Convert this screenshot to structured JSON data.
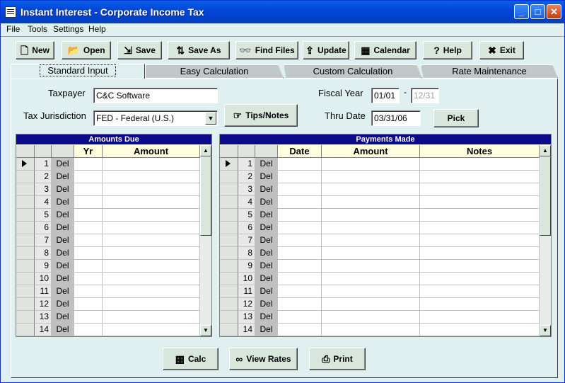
{
  "window": {
    "title": "Instant Interest - Corporate Income Tax",
    "minimize": "_",
    "maximize": "□",
    "close": "✕"
  },
  "menu": [
    {
      "label": "File"
    },
    {
      "label": "Tools"
    },
    {
      "label": "Settings"
    },
    {
      "label": "Help"
    }
  ],
  "toolbar": [
    {
      "label": "New",
      "icon": "page-icon",
      "glyph": "🗋"
    },
    {
      "label": "Open",
      "icon": "open-folder-icon",
      "glyph": "📂"
    },
    {
      "label": "Save",
      "icon": "save-icon",
      "glyph": "⇲"
    },
    {
      "label": "Save As",
      "icon": "save-as-icon",
      "glyph": "⇅"
    },
    {
      "label": "Find Files",
      "icon": "binoculars-icon",
      "glyph": "👓"
    },
    {
      "label": "Update",
      "icon": "update-icon",
      "glyph": "⇪"
    },
    {
      "label": "Calendar",
      "icon": "calendar-icon",
      "glyph": "▦"
    },
    {
      "label": "Help",
      "icon": "question-icon",
      "glyph": "?"
    },
    {
      "label": "Exit",
      "icon": "x-icon",
      "glyph": "✖"
    }
  ],
  "tabs": [
    {
      "label": "Standard Input",
      "active": true
    },
    {
      "label": "Easy Calculation",
      "active": false
    },
    {
      "label": "Custom Calculation",
      "active": false
    },
    {
      "label": "Rate Maintenance",
      "active": false
    }
  ],
  "form": {
    "taxpayer_label": "Taxpayer",
    "taxpayer_value": "C&C Software",
    "jurisdiction_label": "Tax Jurisdiction",
    "jurisdiction_value": "FED - Federal (U.S.)",
    "tips_label": "Tips/Notes",
    "fiscal_year_label": "Fiscal Year",
    "fiscal_start": "01/01",
    "fiscal_sep": "-",
    "fiscal_end": "12/31",
    "thru_date_label": "Thru Date",
    "thru_date_value": "03/31/06",
    "pick_label": "Pick"
  },
  "amounts_due": {
    "title": "Amounts Due",
    "columns": [
      "Yr",
      "Amount"
    ],
    "del_label": "Del",
    "rows": [
      "1",
      "2",
      "3",
      "4",
      "5",
      "6",
      "7",
      "8",
      "9",
      "10",
      "11",
      "12",
      "13",
      "14"
    ]
  },
  "payments_made": {
    "title": "Payments Made",
    "columns": [
      "Date",
      "Amount",
      "Notes"
    ],
    "del_label": "Del",
    "rows": [
      "1",
      "2",
      "3",
      "4",
      "5",
      "6",
      "7",
      "8",
      "9",
      "10",
      "11",
      "12",
      "13",
      "14"
    ]
  },
  "bottom_buttons": [
    {
      "label": "Calc",
      "icon": "calculator-icon",
      "glyph": "▦"
    },
    {
      "label": "View Rates",
      "icon": "glasses-icon",
      "glyph": "∞"
    },
    {
      "label": "Print",
      "icon": "printer-icon",
      "glyph": "⎙"
    }
  ]
}
